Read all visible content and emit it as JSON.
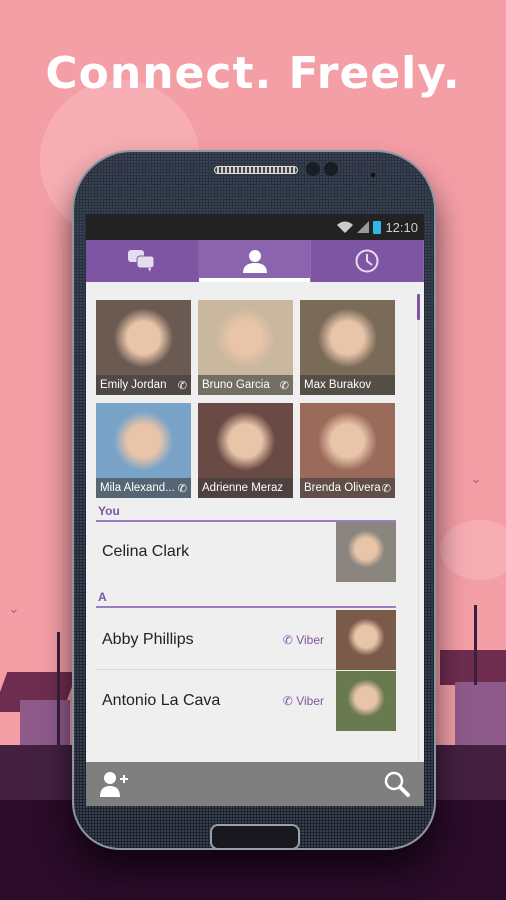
{
  "headline": "Connect. Freely.",
  "status_bar": {
    "time": "12:10",
    "icons": [
      "wifi-icon",
      "signal-icon",
      "battery-icon"
    ]
  },
  "tabs": [
    {
      "name": "chats",
      "icon": "chat-bubbles-icon",
      "active": false
    },
    {
      "name": "contacts",
      "icon": "person-icon",
      "active": true
    },
    {
      "name": "recents",
      "icon": "clock-icon",
      "active": false
    }
  ],
  "favorites": [
    {
      "name": "Emily Jordan",
      "viber": true,
      "color": "#6b5a52"
    },
    {
      "name": "Bruno Garcia",
      "viber": true,
      "color": "#c9b89e"
    },
    {
      "name": "Max Burakov",
      "viber": false,
      "color": "#7a6a58"
    },
    {
      "name": "Mila Alexand...",
      "viber": true,
      "color": "#7aa3c8"
    },
    {
      "name": "Adrienne Meraz",
      "viber": false,
      "color": "#6a4a44"
    },
    {
      "name": "Brenda Olivera",
      "viber": true,
      "color": "#9a6a5a"
    }
  ],
  "sections": [
    {
      "label": "You",
      "contacts": [
        {
          "name": "Celina Clark",
          "viber_label": "",
          "color": "#8a857f"
        }
      ]
    },
    {
      "label": "A",
      "contacts": [
        {
          "name": "Abby Phillips",
          "viber_label": "Viber",
          "color": "#7a5a48"
        },
        {
          "name": "Antonio La Cava",
          "viber_label": "Viber",
          "color": "#6a7a50"
        }
      ]
    }
  ],
  "bottom_bar": {
    "left_icon": "add-contact-icon",
    "right_icon": "search-icon"
  }
}
